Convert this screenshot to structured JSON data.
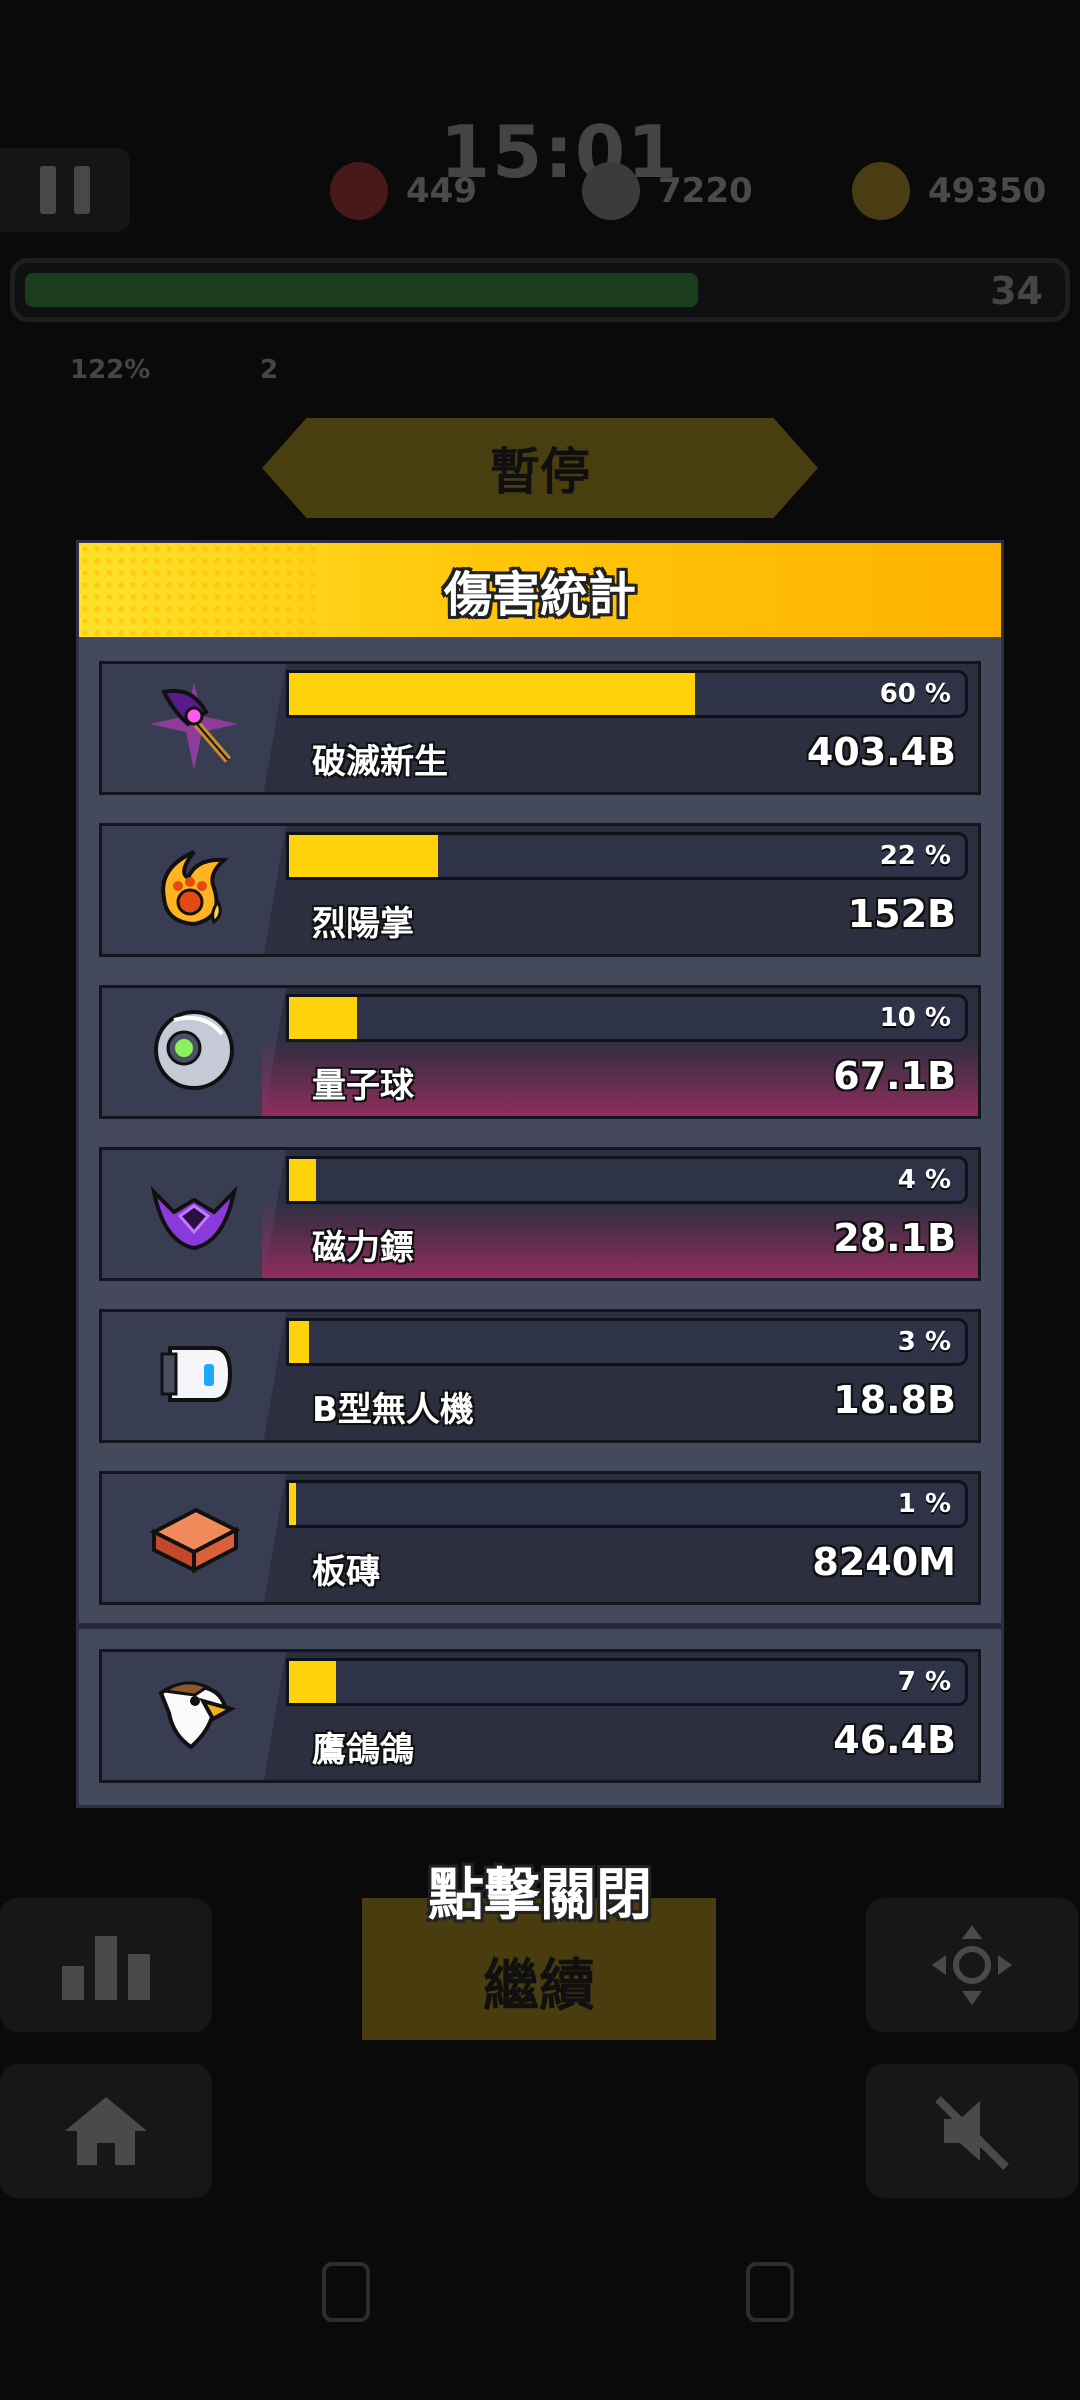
{
  "hud": {
    "timer": "15:01",
    "hearts": "449",
    "kills": "7220",
    "coins": "49350",
    "level": "34",
    "xp_progress": 0.66,
    "stat_a": "122%",
    "stat_b": "2"
  },
  "pause_title": "暫停",
  "modal": {
    "title": "傷害統計",
    "items": [
      {
        "icon": "purple-axe-icon",
        "name": "破滅新生",
        "percent_label": "60 %",
        "percent": 60,
        "value": "403.4B",
        "highlight": false
      },
      {
        "icon": "fire-paw-icon",
        "name": "烈陽掌",
        "percent_label": "22 %",
        "percent": 22,
        "value": "152B",
        "highlight": false
      },
      {
        "icon": "quantum-orb-icon",
        "name": "量子球",
        "percent_label": "10 %",
        "percent": 10,
        "value": "67.1B",
        "highlight": true
      },
      {
        "icon": "magnetic-dart-icon",
        "name": "磁力鏢",
        "percent_label": "4 %",
        "percent": 4,
        "value": "28.1B",
        "highlight": true
      },
      {
        "icon": "drone-b-icon",
        "name": "B型無人機",
        "percent_label": "3 %",
        "percent": 3,
        "value": "18.8B",
        "highlight": false
      },
      {
        "icon": "brick-icon",
        "name": "板磚",
        "percent_label": "1 %",
        "percent": 1,
        "value": "8240M",
        "highlight": false
      }
    ],
    "pet": {
      "icon": "eagle-icon",
      "name": "鷹鴿鴿",
      "percent_label": "7 %",
      "percent": 7,
      "value": "46.4B"
    }
  },
  "close_hint": "點擊關閉",
  "continue_label": "繼續",
  "colors": {
    "accent": "#ffd20a",
    "panel": "#45495c",
    "row": "#2b2f3f",
    "highlight": "#8f2d5e"
  }
}
